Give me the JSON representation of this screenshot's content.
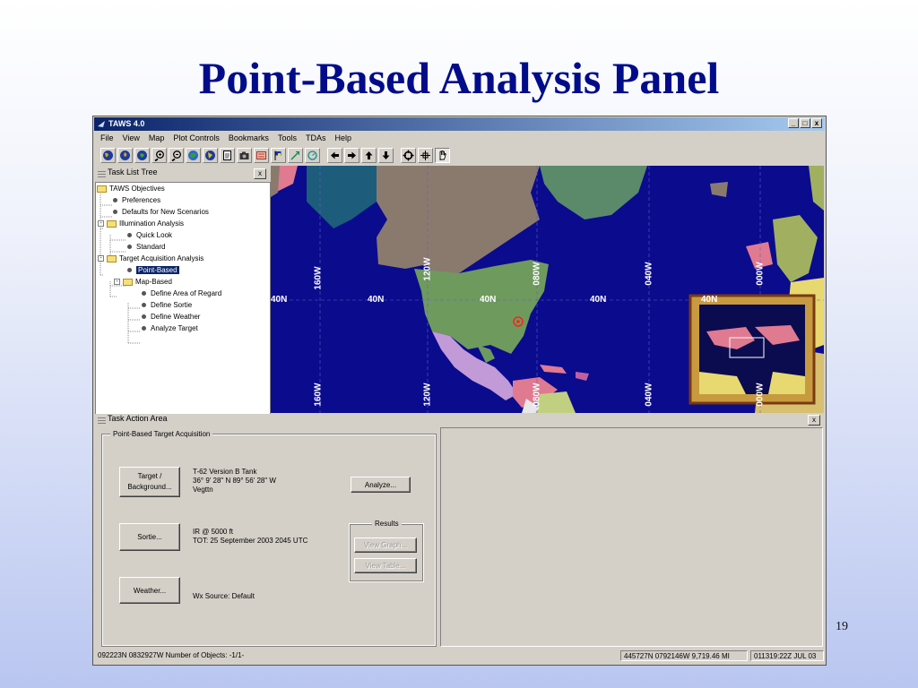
{
  "slide": {
    "title": "Point-Based Analysis Panel",
    "page_number": "19"
  },
  "window": {
    "title": "TAWS 4.0",
    "controls": [
      "_",
      "□",
      "x"
    ]
  },
  "menu": [
    "File",
    "View",
    "Map",
    "Plot Controls",
    "Bookmarks",
    "Tools",
    "TDAs",
    "Help"
  ],
  "toolbar_icons": [
    "globe-icon",
    "globe-icon",
    "globe-icon",
    "zoom-in-icon",
    "zoom-out-icon",
    "globe-icon",
    "globe-icon",
    "document-icon",
    "camera-icon",
    "map-icon",
    "flag-icon",
    "line-tool-icon",
    "circle-tool-icon",
    "arrow-left-icon",
    "arrow-right-icon",
    "arrow-up-icon",
    "arrow-down-icon",
    "target-icon",
    "crosshair-icon",
    "hand-icon"
  ],
  "task_list": {
    "title": "Task List Tree",
    "close": "x",
    "nodes": [
      {
        "label": "TAWS Objectives"
      },
      {
        "label": "Preferences"
      },
      {
        "label": "Defaults for New Scenarios"
      },
      {
        "label": "Illumination Analysis"
      },
      {
        "label": "Quick Look"
      },
      {
        "label": "Standard"
      },
      {
        "label": "Target Acquisition Analysis"
      },
      {
        "label": "Point-Based"
      },
      {
        "label": "Map-Based"
      },
      {
        "label": "Define Area of Regard"
      },
      {
        "label": "Define Sortie"
      },
      {
        "label": "Define Weather"
      },
      {
        "label": "Analyze Target"
      }
    ]
  },
  "map": {
    "lat_labels": [
      "40N",
      "40N",
      "40N",
      "40N",
      "40N"
    ],
    "lon_labels": [
      "160W",
      "120W",
      "080W",
      "040W",
      "000W"
    ],
    "lon_labels_bottom": [
      "160W",
      "120W",
      "080W",
      "040W",
      "000W"
    ],
    "colors": {
      "ocean": "#0b0b8e",
      "usa": "#6e9a5e",
      "canada": "#8a7a6e",
      "mexico": "#c39ad8",
      "greenland": "#5a8a6a",
      "alaska": "#1d5c7a"
    }
  },
  "task_action": {
    "title": "Task Action Area",
    "close": "x",
    "group_label": "Point-Based Target Acquisition",
    "target_button": "Target / Background...",
    "target_info": [
      "T-62 Version B Tank",
      "36° 9' 28\" N  89° 56' 28\" W",
      "Vegttn"
    ],
    "analyze_button": "Analyze...",
    "results_label": "Results",
    "view_graph_button": "View Graph...",
    "view_table_button": "View Table...",
    "sortie_button": "Sortie...",
    "sortie_info": [
      "IR @   5000 ft",
      "TOT: 25 September 2003 2045 UTC"
    ],
    "weather_button": "Weather...",
    "weather_info": "Wx Source: Default"
  },
  "status": {
    "left": "092223N 0832927W  Number of Objects: -1/1-",
    "coords": "445727N 0792146W  9,719.46 MI",
    "time": "011319:22Z JUL 03"
  }
}
